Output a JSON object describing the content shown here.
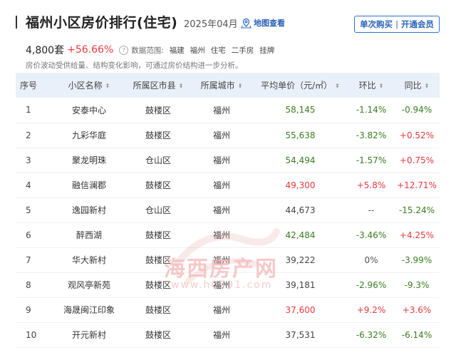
{
  "header": {
    "title": "福州小区房价排行(住宅)",
    "date": "2025年04月",
    "map_link": "地图查看",
    "buttons": {
      "buy": "单次购买",
      "separator": "|",
      "member": "开通会员"
    }
  },
  "stats": {
    "count": "4,800套",
    "change": "+56.66%",
    "help_icon": "?",
    "scope_label": "数据范围:",
    "scope_tags": [
      "福建",
      "福州",
      "住宅",
      "二手房",
      "挂牌"
    ],
    "note": "房价波动受供给量、结构变化影响，可通过房价结构进一步分析。"
  },
  "table": {
    "columns": [
      {
        "label": "序号",
        "sortable": false
      },
      {
        "label": "小区名称",
        "sortable": true
      },
      {
        "label": "所属区市县",
        "sortable": true
      },
      {
        "label": "所属城市",
        "sortable": true
      },
      {
        "label": "平均单价（元/㎡）",
        "sortable": true
      },
      {
        "label": "环比",
        "sortable": true
      },
      {
        "label": "同比",
        "sortable": true
      }
    ],
    "sort_glyph": "⬍",
    "rows": [
      {
        "rank": "1",
        "name": "安泰中心",
        "district": "鼓楼区",
        "city": "福州",
        "price": "58,145",
        "mom": "-1.14%",
        "yoy": "-0.94%"
      },
      {
        "rank": "2",
        "name": "九彩华庭",
        "district": "鼓楼区",
        "city": "福州",
        "price": "55,638",
        "mom": "-3.82%",
        "yoy": "+0.52%"
      },
      {
        "rank": "3",
        "name": "聚龙明珠",
        "district": "仓山区",
        "city": "福州",
        "price": "54,494",
        "mom": "-1.57%",
        "yoy": "+0.75%"
      },
      {
        "rank": "4",
        "name": "融信澜郡",
        "district": "鼓楼区",
        "city": "福州",
        "price": "49,300",
        "mom": "+5.8%",
        "yoy": "+12.71%"
      },
      {
        "rank": "5",
        "name": "逸园新村",
        "district": "仓山区",
        "city": "福州",
        "price": "44,673",
        "mom": "--",
        "yoy": "-15.24%"
      },
      {
        "rank": "6",
        "name": "醉西湖",
        "district": "鼓楼区",
        "city": "福州",
        "price": "42,484",
        "mom": "-3.46%",
        "yoy": "+4.25%"
      },
      {
        "rank": "7",
        "name": "华大新村",
        "district": "鼓楼区",
        "city": "福州",
        "price": "39,222",
        "mom": "0%",
        "yoy": "-3.99%"
      },
      {
        "rank": "8",
        "name": "观风亭新苑",
        "district": "鼓楼区",
        "city": "福州",
        "price": "39,181",
        "mom": "-2.96%",
        "yoy": "-9.3%"
      },
      {
        "rank": "9",
        "name": "海晟闽江印象",
        "district": "鼓楼区",
        "city": "福州",
        "price": "37,600",
        "mom": "+9.2%",
        "yoy": "+3.6%"
      },
      {
        "rank": "10",
        "name": "开元新村",
        "district": "鼓楼区",
        "city": "福州",
        "price": "37,531",
        "mom": "-6.32%",
        "yoy": "-6.14%"
      }
    ],
    "price_colors": [
      "green",
      "green",
      "green",
      "red",
      "gray",
      "green",
      "gray",
      "gray",
      "red",
      "gray"
    ]
  },
  "watermark": {
    "text": "海西房产网",
    "url": "www.h0591.com"
  },
  "colors": {
    "accent": "#2a63b8",
    "rise": "#e8383d",
    "fall": "#3a7d1f",
    "header_bg": "#eaf0f9"
  }
}
